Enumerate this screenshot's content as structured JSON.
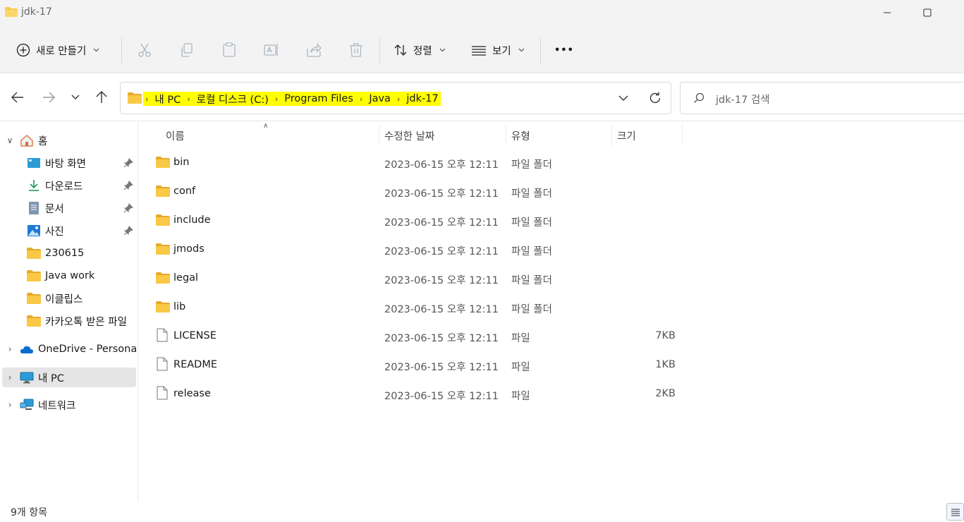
{
  "window": {
    "title": "jdk-17"
  },
  "toolbar": {
    "new_label": "새로 만들기",
    "sort_label": "정렬",
    "view_label": "보기",
    "more_label": "•••"
  },
  "address": {
    "crumbs": [
      "내 PC",
      "로컬 디스크 (C:)",
      "Program Files",
      "Java",
      "jdk-17"
    ],
    "highlight_color": "#ffff00"
  },
  "search": {
    "placeholder": "jdk-17 검색"
  },
  "sidebar": {
    "home": "홈",
    "quick": [
      {
        "label": "바탕 화면",
        "icon": "desktop-icon",
        "pinned": true
      },
      {
        "label": "다운로드",
        "icon": "download-icon",
        "pinned": true
      },
      {
        "label": "문서",
        "icon": "document-icon",
        "pinned": true
      },
      {
        "label": "사진",
        "icon": "pictures-icon",
        "pinned": true
      },
      {
        "label": "230615",
        "icon": "folder-icon",
        "pinned": false
      },
      {
        "label": "Java work",
        "icon": "folder-icon",
        "pinned": false
      },
      {
        "label": "이클립스",
        "icon": "folder-icon",
        "pinned": false
      },
      {
        "label": "카카오톡 받은 파일",
        "icon": "folder-icon",
        "pinned": false
      }
    ],
    "onedrive": "OneDrive - Personal",
    "thispc": "내 PC",
    "network": "네트워크"
  },
  "columns": {
    "name": "이름",
    "modified": "수정한 날짜",
    "type": "유형",
    "size": "크기"
  },
  "files": [
    {
      "name": "bin",
      "modified": "2023-06-15 오후 12:11",
      "type": "파일 폴더",
      "size": "",
      "kind": "folder"
    },
    {
      "name": "conf",
      "modified": "2023-06-15 오후 12:11",
      "type": "파일 폴더",
      "size": "",
      "kind": "folder"
    },
    {
      "name": "include",
      "modified": "2023-06-15 오후 12:11",
      "type": "파일 폴더",
      "size": "",
      "kind": "folder"
    },
    {
      "name": "jmods",
      "modified": "2023-06-15 오후 12:11",
      "type": "파일 폴더",
      "size": "",
      "kind": "folder"
    },
    {
      "name": "legal",
      "modified": "2023-06-15 오후 12:11",
      "type": "파일 폴더",
      "size": "",
      "kind": "folder"
    },
    {
      "name": "lib",
      "modified": "2023-06-15 오후 12:11",
      "type": "파일 폴더",
      "size": "",
      "kind": "folder"
    },
    {
      "name": "LICENSE",
      "modified": "2023-06-15 오후 12:11",
      "type": "파일",
      "size": "7KB",
      "kind": "file"
    },
    {
      "name": "README",
      "modified": "2023-06-15 오후 12:11",
      "type": "파일",
      "size": "1KB",
      "kind": "file"
    },
    {
      "name": "release",
      "modified": "2023-06-15 오후 12:11",
      "type": "파일",
      "size": "2KB",
      "kind": "file"
    }
  ],
  "status": {
    "item_count": "9개 항목"
  },
  "colors": {
    "folder": "#f8c846",
    "accent": "#0067c0",
    "selected_bg": "#e5e5e5"
  }
}
